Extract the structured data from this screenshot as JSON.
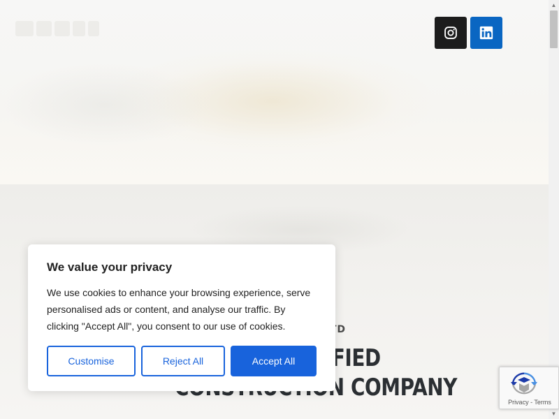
{
  "social": {
    "instagram_icon": "instagram-icon",
    "linkedin_icon": "linkedin-icon",
    "instagram_color": "#1c1c1c",
    "linkedin_color": "#0a66c2"
  },
  "section": {
    "eyebrow": "TD",
    "heading_line_1": "ALIFIED",
    "heading_line_2": "CONSTRUCTION COMPANY"
  },
  "cookie_banner": {
    "title": "We value your privacy",
    "body": "We use cookies to enhance your browsing experience, serve personalised ads or content, and analyse our traffic. By clicking \"Accept All\", you consent to our use of cookies.",
    "customise_label": "Customise",
    "reject_label": "Reject All",
    "accept_label": "Accept All",
    "accent_color": "#1863dc"
  },
  "recaptcha": {
    "privacy_label": "Privacy",
    "separator": " - ",
    "terms_label": "Terms"
  }
}
